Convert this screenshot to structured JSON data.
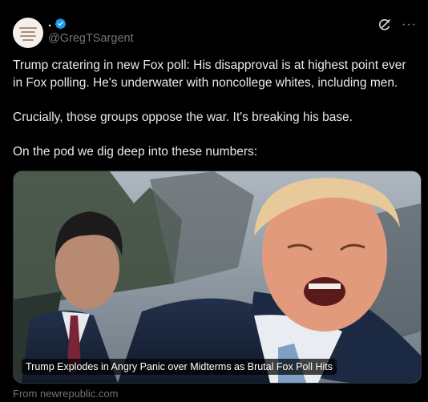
{
  "author": {
    "display_name": ".",
    "handle": "@GregTSargent",
    "verified": true,
    "avatar_icon": "avatar-image"
  },
  "header_icons": {
    "grok": "grok-icon",
    "more": "···"
  },
  "tweet": {
    "paragraphs": [
      "Trump cratering in new Fox poll: His disapproval is at highest point ever in Fox polling. He's underwater with noncollege whites, including men.",
      "Crucially, those groups oppose the war. It's breaking his base.",
      "On the pod we dig deep into these numbers:"
    ]
  },
  "link_card": {
    "title": "Trump Explodes in Angry Panic over Midterms as Brutal Fox Poll Hits",
    "source": "From newrepublic.com",
    "image": "photo-two-men-outdoors"
  },
  "colors": {
    "background": "#000000",
    "text": "#e7e9ea",
    "muted": "#71767b",
    "verified_blue": "#1d9bf0"
  }
}
